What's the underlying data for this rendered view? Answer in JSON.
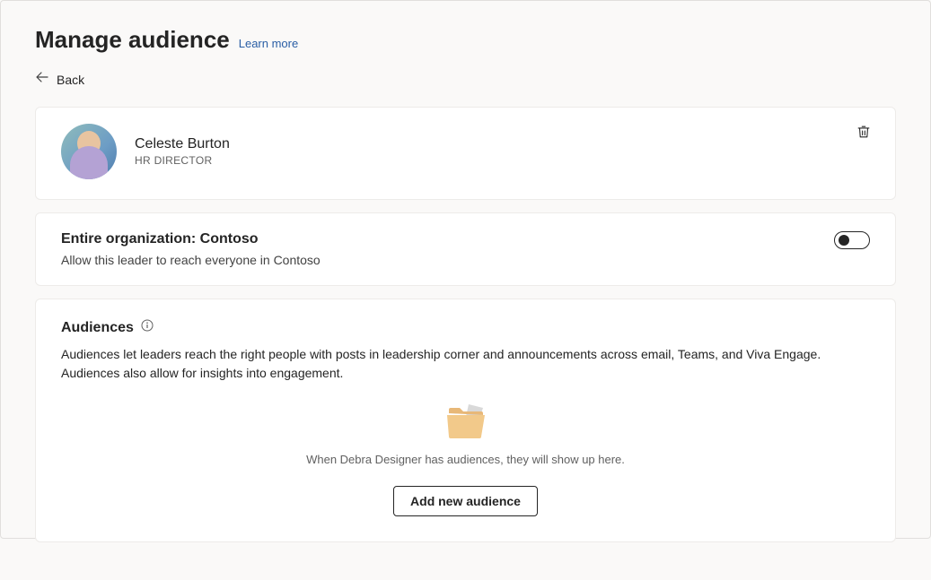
{
  "header": {
    "title": "Manage audience",
    "learn_more": "Learn more"
  },
  "nav": {
    "back": "Back"
  },
  "leader": {
    "name": "Celeste Burton",
    "role": "HR DIRECTOR"
  },
  "org": {
    "title": "Entire organization: Contoso",
    "description": "Allow this leader to reach everyone in Contoso",
    "toggle_on": false
  },
  "audiences": {
    "title": "Audiences",
    "description": "Audiences let leaders reach the right people with posts in leadership corner and announcements across email, Teams, and Viva Engage. Audiences also allow for insights into engagement.",
    "empty_text": "When Debra Designer has audiences, they will show up here.",
    "add_button": "Add new audience"
  }
}
